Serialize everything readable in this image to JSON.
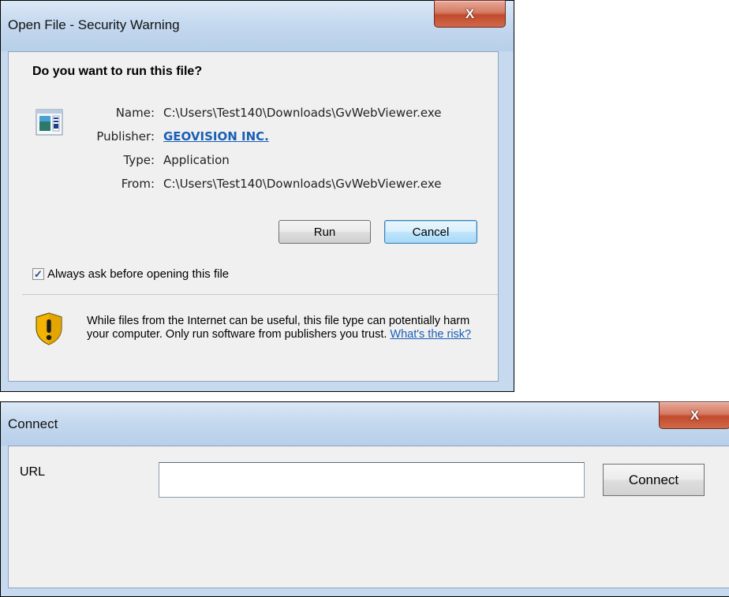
{
  "dialog1": {
    "title": "Open File - Security Warning",
    "close_glyph": "X",
    "question": "Do you want to run this file?",
    "icon": "application-icon",
    "fields": {
      "name_label": "Name:",
      "name_value": "C:\\Users\\Test140\\Downloads\\GvWebViewer.exe",
      "publisher_label": "Publisher:",
      "publisher_value": "GEOVISION INC.",
      "type_label": "Type:",
      "type_value": "Application",
      "from_label": "From:",
      "from_value": "C:\\Users\\Test140\\Downloads\\GvWebViewer.exe"
    },
    "run_label": "Run",
    "cancel_label": "Cancel",
    "checkbox_label": "Always ask before opening this file",
    "checkbox_checked": true,
    "warning_text": "While files from the Internet can be useful, this file type can potentially harm your computer. Only run software from publishers you trust.",
    "risk_link": "What's the risk?"
  },
  "dialog2": {
    "title": "Connect",
    "close_glyph": "X",
    "url_label": "URL",
    "url_value": "",
    "connect_label": "Connect"
  },
  "colors": {
    "link": "#1a5fb4",
    "title_bar": "#c5d9ef",
    "close_button": "#c24a2c"
  }
}
